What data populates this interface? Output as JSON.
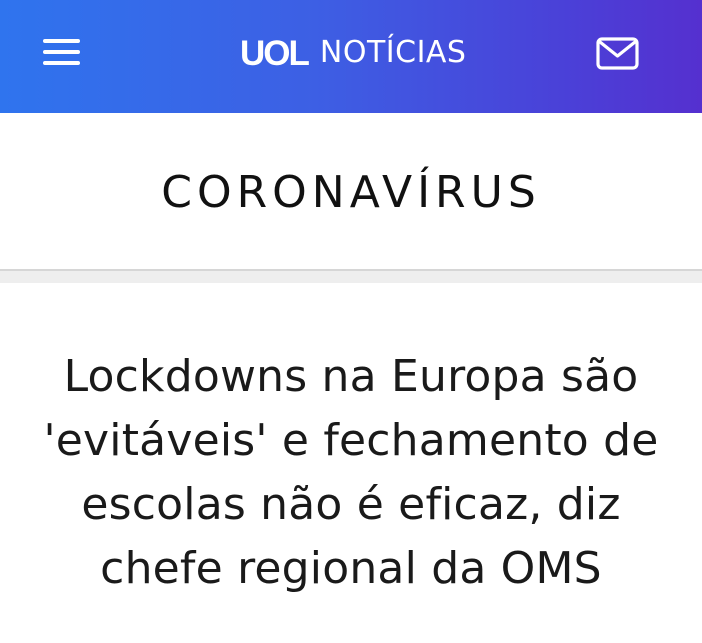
{
  "header": {
    "brand_logo": "UOL",
    "brand_section": "NOTÍCIAS",
    "menu_icon": "hamburger-menu-icon",
    "mail_icon": "envelope-icon",
    "gradient_start": "#2f74ee",
    "gradient_end": "#5530cf"
  },
  "section": {
    "title": "CORONAVÍRUS"
  },
  "article": {
    "headline": "Lockdowns na Europa são 'evitáveis' e fechamento de escolas não é eficaz, diz chefe regional da OMS"
  }
}
